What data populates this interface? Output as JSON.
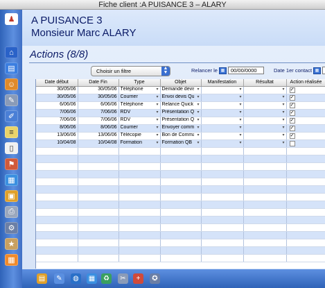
{
  "window": {
    "title": "Fiche client :A PUISANCE 3 – ALARY"
  },
  "header": {
    "client_name": "A PUISANCE 3",
    "contact_name": "Monsieur Marc ALARY"
  },
  "actions": {
    "title": "Actions (8/8)",
    "filter": {
      "selected": "Choisir un filtre"
    },
    "relancer_label": "Relancer le",
    "relancer_value": "00/00/0000",
    "date_contact_label": "Date 1er contact"
  },
  "table": {
    "columns": [
      "Date début",
      "Date Fin",
      "Type",
      "Objet",
      "Manifestation",
      "Résultat",
      "Action réalisée"
    ],
    "rows": [
      {
        "start": "30/05/06",
        "end": "30/05/06",
        "type": "Téléphone",
        "object": "Demande devis",
        "done": true
      },
      {
        "start": "30/05/06",
        "end": "30/05/06",
        "type": "Courrier",
        "object": "Envoi devis Qui",
        "done": true
      },
      {
        "start": "6/06/06",
        "end": "6/06/06",
        "type": "Téléphone",
        "object": "Relance Quick E",
        "done": true
      },
      {
        "start": "7/06/06",
        "end": "7/06/06",
        "type": "RDV",
        "object": "Présentation Qu",
        "done": true
      },
      {
        "start": "7/06/06",
        "end": "7/06/06",
        "type": "RDV",
        "object": "Présentation Qu",
        "done": true
      },
      {
        "start": "8/06/06",
        "end": "8/06/06",
        "type": "Courrier",
        "object": "Envoyer comm:",
        "done": true
      },
      {
        "start": "13/06/06",
        "end": "13/06/06",
        "type": "Télécopie",
        "object": "Bon de Comma",
        "done": true
      },
      {
        "start": "10/04/08",
        "end": "10/04/08",
        "type": "Formation",
        "object": "Formation QB",
        "done": false
      }
    ],
    "empty_rows": 15
  },
  "sidebar_icons": [
    "client-card-icon",
    "home-icon",
    "list-icon",
    "contacts-icon",
    "tools-icon",
    "edit-icon",
    "notes-icon",
    "document-icon",
    "filter-icon",
    "calendar-icon",
    "package-icon",
    "print-icon",
    "settings-icon",
    "favorites-icon",
    "grid-icon"
  ],
  "bottom_icons": [
    "save-icon",
    "edit-icon",
    "globe-icon",
    "calendar-icon",
    "trash-icon",
    "tools-icon",
    "add-icon",
    "compass-icon"
  ]
}
